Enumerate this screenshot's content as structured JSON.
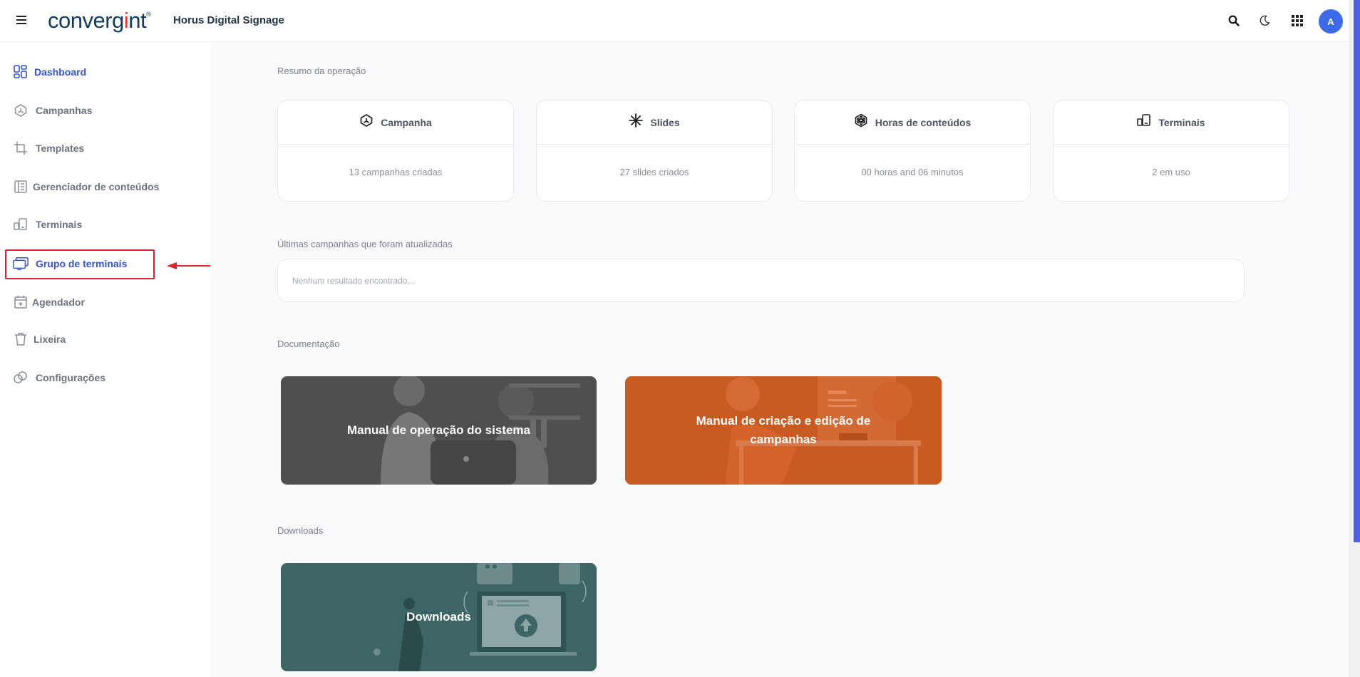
{
  "header": {
    "logo_text": "convergint",
    "app_title": "Horus Digital Signage",
    "icons": [
      "menu-icon",
      "search-icon",
      "moon-icon",
      "apps-grid-icon"
    ],
    "avatar_initial": "A"
  },
  "sidebar": {
    "items": [
      {
        "label": "Dashboard",
        "icon": "dashboard-icon",
        "active": true
      },
      {
        "label": "Campanhas",
        "icon": "campaign-icon",
        "active": false
      },
      {
        "label": "Templates",
        "icon": "crop-icon",
        "active": false
      },
      {
        "label": "Gerenciador de conteúdos",
        "icon": "content-manager-icon",
        "active": false
      },
      {
        "label": "Terminais",
        "icon": "devices-icon",
        "active": false
      },
      {
        "label": "Grupo de terminais",
        "icon": "monitor-group-icon",
        "active": true
      },
      {
        "label": "Agendador",
        "icon": "calendar-icon",
        "active": false
      },
      {
        "label": "Lixeira",
        "icon": "trash-icon",
        "active": false
      },
      {
        "label": "Configurações",
        "icon": "settings-icon",
        "active": false
      }
    ]
  },
  "main": {
    "summary_title": "Resumo da operação",
    "stats": [
      {
        "title": "Campanha",
        "value": "13 campanhas criadas",
        "icon": "campaign-icon"
      },
      {
        "title": "Slides",
        "value": "27 slides criados",
        "icon": "sparkle-icon"
      },
      {
        "title": "Horas de conteúdos",
        "value": "00 horas and 06 minutos",
        "icon": "film-reel-icon"
      },
      {
        "title": "Terminais",
        "value": "2 em uso",
        "icon": "devices-icon"
      }
    ],
    "recent_title": "Últimas campanhas que foram atualizadas",
    "recent_empty": "Nenhum resultado encontrado...",
    "docs_title": "Documentação",
    "docs": [
      {
        "title": "Manual de operação do sistema",
        "color": "#4f4f4f"
      },
      {
        "title": "Manual de criação e edição de campanhas",
        "color": "#c85a22"
      }
    ],
    "downloads_title": "Downloads",
    "downloads": [
      {
        "title": "Downloads",
        "color": "#3d6565"
      }
    ]
  },
  "colors": {
    "accent": "#3454d1",
    "highlight": "#e0202e",
    "avatar": "#3d6ae8"
  }
}
